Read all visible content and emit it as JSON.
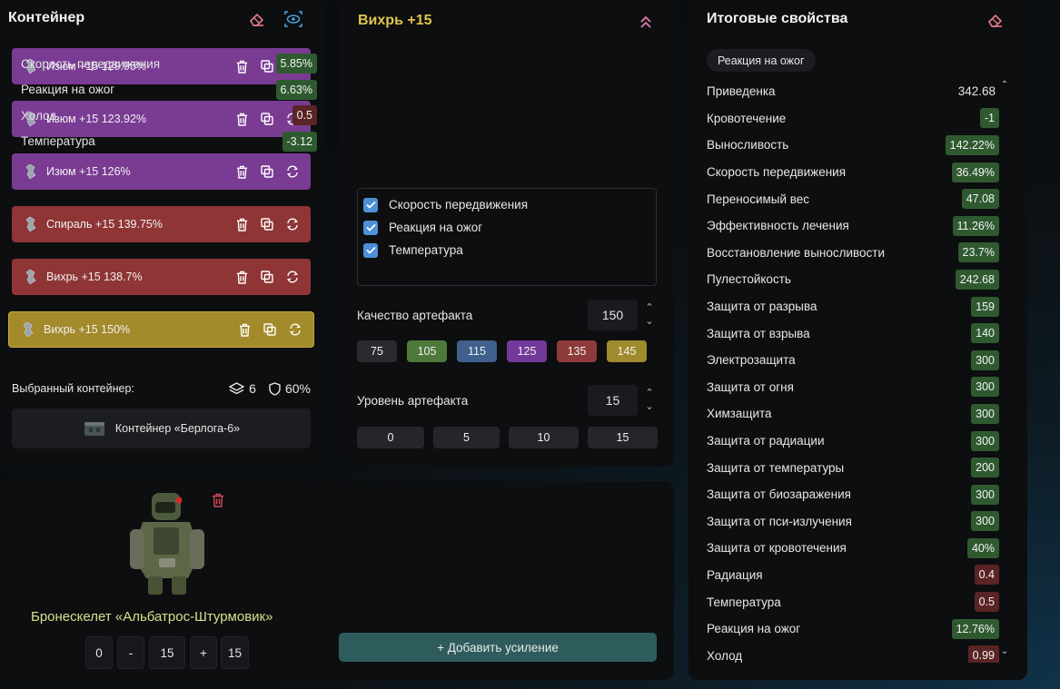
{
  "container": {
    "title": "Контейнер",
    "items": [
      {
        "name": "Изюм",
        "level": "+15",
        "percent": "129.95%",
        "color": "#7a3b93"
      },
      {
        "name": "Изюм",
        "level": "+15",
        "percent": "123.92%",
        "color": "#7a3b93"
      },
      {
        "name": "Изюм",
        "level": "+15",
        "percent": "126%",
        "color": "#7a3b93"
      },
      {
        "name": "Спираль",
        "level": "+15",
        "percent": "139.75%",
        "color": "#8f3535"
      },
      {
        "name": "Вихрь",
        "level": "+15",
        "percent": "138.7%",
        "color": "#8f3535"
      },
      {
        "name": "Вихрь",
        "level": "+15",
        "percent": "150%",
        "color": "#a38a2a"
      }
    ],
    "selected_label": "Выбранный контейнер:",
    "slots": "6",
    "protection": "60%",
    "container_name": "Контейнер «Берлога-6»"
  },
  "artifact": {
    "title": "Вихрь +15",
    "properties": [
      {
        "name": "Скорость передвижения",
        "value": "5.85%",
        "tone": "green"
      },
      {
        "name": "Реакция на ожог",
        "value": "6.63%",
        "tone": "green"
      },
      {
        "name": "Холод",
        "value": "0.5",
        "tone": "red"
      },
      {
        "name": "Температура",
        "value": "-3.12",
        "tone": "green"
      }
    ],
    "checks": [
      "Скорость передвижения",
      "Реакция на ожог",
      "Температура"
    ],
    "quality_label": "Качество артефакта",
    "quality_value": "150",
    "quality_presets": [
      {
        "label": "75",
        "color": "#2a2b2e"
      },
      {
        "label": "105",
        "color": "#4d7a3a"
      },
      {
        "label": "115",
        "color": "#3f5f8c"
      },
      {
        "label": "125",
        "color": "#73399a"
      },
      {
        "label": "135",
        "color": "#8f3a3a"
      },
      {
        "label": "145",
        "color": "#a08a2e"
      }
    ],
    "level_label": "Уровень артефакта",
    "level_value": "15",
    "level_presets": [
      "0",
      "5",
      "10",
      "15"
    ]
  },
  "armor": {
    "name": "Бронескелет «Альбатрос-Штурмовик»",
    "min": "0",
    "minus": "-",
    "value": "15",
    "plus": "+",
    "max": "15",
    "add_button": "+ Добавить усиление"
  },
  "summary": {
    "title": "Итоговые свойства",
    "filter_chip": "Реакция на ожог",
    "rows": [
      {
        "name": "Приведенка",
        "value": "342.68",
        "tone": "plain"
      },
      {
        "name": "Кровотечение",
        "value": "-1",
        "tone": "green"
      },
      {
        "name": "Выносливость",
        "value": "142.22%",
        "tone": "green"
      },
      {
        "name": "Скорость передвижения",
        "value": "36.49%",
        "tone": "green"
      },
      {
        "name": "Переносимый вес",
        "value": "47.08",
        "tone": "green"
      },
      {
        "name": "Эффективность лечения",
        "value": "11.26%",
        "tone": "green"
      },
      {
        "name": "Восстановление выносливости",
        "value": "23.7%",
        "tone": "green"
      },
      {
        "name": "Пулестойкость",
        "value": "242.68",
        "tone": "green"
      },
      {
        "name": "Защита от разрыва",
        "value": "159",
        "tone": "green"
      },
      {
        "name": "Защита от взрыва",
        "value": "140",
        "tone": "green"
      },
      {
        "name": "Электрозащита",
        "value": "300",
        "tone": "green"
      },
      {
        "name": "Защита от огня",
        "value": "300",
        "tone": "green"
      },
      {
        "name": "Химзащита",
        "value": "300",
        "tone": "green"
      },
      {
        "name": "Защита от радиации",
        "value": "300",
        "tone": "green"
      },
      {
        "name": "Защита от температуры",
        "value": "200",
        "tone": "green"
      },
      {
        "name": "Защита от биозаражения",
        "value": "300",
        "tone": "green"
      },
      {
        "name": "Защита от пси-излучения",
        "value": "300",
        "tone": "green"
      },
      {
        "name": "Защита от кровотечения",
        "value": "40%",
        "tone": "green"
      },
      {
        "name": "Радиация",
        "value": "0.4",
        "tone": "red"
      },
      {
        "name": "Температура",
        "value": "0.5",
        "tone": "red"
      },
      {
        "name": "Реакция на ожог",
        "value": "12.76%",
        "tone": "green"
      },
      {
        "name": "Холод",
        "value": "0.99",
        "tone": "red"
      }
    ]
  },
  "colors": {
    "accent_yellow": "#e0c64a",
    "positive": "#2f5a30",
    "negative": "#5a2424",
    "checkbox": "#4d90d8",
    "add_button": "#2e5c5c"
  }
}
